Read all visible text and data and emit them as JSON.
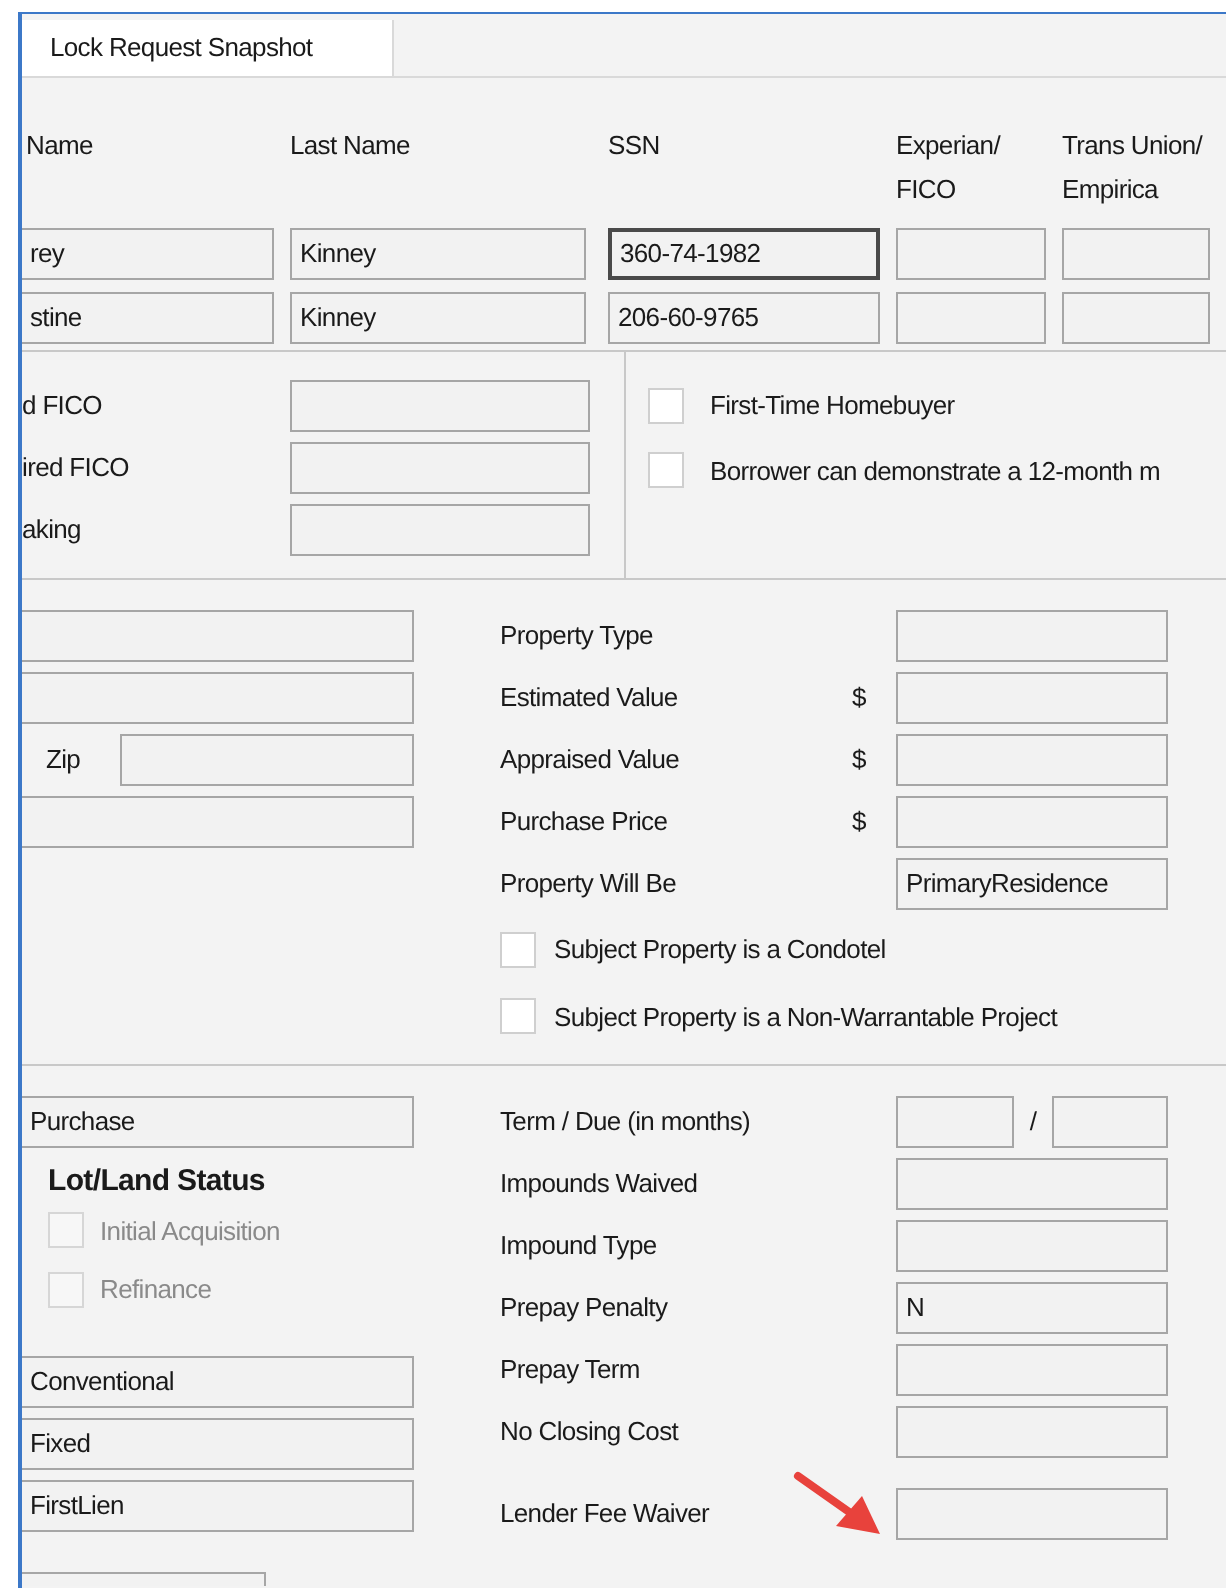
{
  "tabs": [
    {
      "label": "Lock Request Snapshot",
      "selected": true
    }
  ],
  "borrowers": {
    "columns": [
      "Name",
      "Last Name",
      "SSN",
      "Experian/ FICO",
      "Trans Union/ Empirica"
    ],
    "rows": [
      {
        "first_name": "rey",
        "last_name": "Kinney",
        "ssn": "360-74-1982",
        "ssn_focused": true
      },
      {
        "first_name": "stine",
        "last_name": "Kinney",
        "ssn": "206-60-9765",
        "ssn_focused": false
      }
    ]
  },
  "credit_fields": [
    {
      "label": "d FICO"
    },
    {
      "label": "ired FICO"
    },
    {
      "label": "aking"
    }
  ],
  "flags": [
    {
      "label": "First-Time Homebuyer",
      "checked": false
    },
    {
      "label": "Borrower can demonstrate a 12-month m",
      "checked": false
    }
  ],
  "address_fields": [
    {
      "kind": "plain"
    },
    {
      "kind": "plain"
    },
    {
      "kind": "labeled",
      "label": "Zip"
    },
    {
      "kind": "plain"
    }
  ],
  "property_fields": [
    {
      "label": "Property Type"
    },
    {
      "label": "Estimated Value",
      "currency": "$"
    },
    {
      "label": "Appraised Value",
      "currency": "$"
    },
    {
      "label": "Purchase Price",
      "currency": "$"
    },
    {
      "label": "Property Will Be",
      "value": "PrimaryResidence"
    }
  ],
  "property_checks": [
    {
      "label": "Subject Property is a Condotel",
      "checked": false
    },
    {
      "label": "Subject Property is a Non-Warrantable Project",
      "checked": false
    }
  ],
  "loan_purpose": "Purchase",
  "lot_land": {
    "title": "Lot/Land Status",
    "options": [
      {
        "label": "Initial Acquisition",
        "checked": false,
        "disabled": true
      },
      {
        "label": "Refinance",
        "checked": false,
        "disabled": true
      }
    ]
  },
  "loan_fields": [
    "Conventional",
    "Fixed",
    "FirstLien"
  ],
  "loan_terms": [
    {
      "kind": "pair",
      "label": "Term / Due (in months)",
      "separator": "/"
    },
    {
      "kind": "single",
      "label": "Impounds Waived"
    },
    {
      "kind": "single",
      "label": "Impound Type"
    },
    {
      "kind": "single",
      "label": "Prepay Penalty",
      "value": "N"
    },
    {
      "kind": "single",
      "label": "Prepay Term"
    },
    {
      "kind": "single",
      "label": "No Closing Cost"
    },
    {
      "kind": "single",
      "label": "Lender Fee Waiver",
      "pointed_at": true
    }
  ]
}
